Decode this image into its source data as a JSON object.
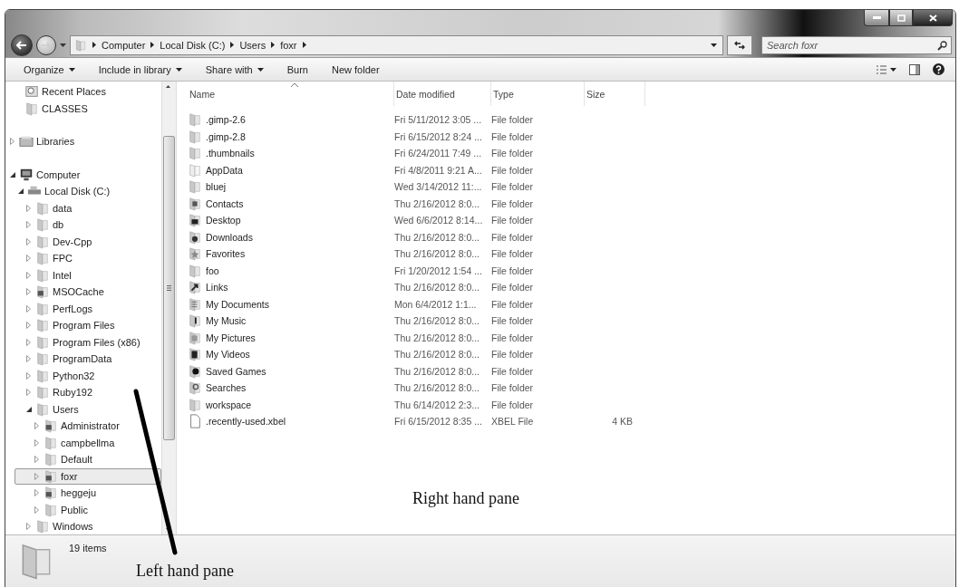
{
  "address_bar": {
    "breadcrumbs": [
      "Computer",
      "Local Disk (C:)",
      "Users",
      "foxr"
    ]
  },
  "search": {
    "placeholder": "Search foxr"
  },
  "toolbar": {
    "items": [
      {
        "label": "Organize",
        "dropdown": true
      },
      {
        "label": "Include in library",
        "dropdown": true
      },
      {
        "label": "Share with",
        "dropdown": true
      },
      {
        "label": "Burn",
        "dropdown": false
      },
      {
        "label": "New folder",
        "dropdown": false
      }
    ]
  },
  "nav_pane": {
    "sections": [
      {
        "items": [
          {
            "label": "Recent Places",
            "kind": "recent",
            "selected": false
          },
          {
            "label": "CLASSES",
            "kind": "folder",
            "selected": false
          }
        ]
      },
      {
        "items": [
          {
            "label": "Libraries",
            "kind": "library",
            "expanded": false,
            "selected": false
          }
        ]
      },
      {
        "items": [
          {
            "label": "Computer",
            "kind": "computer",
            "expanded": true,
            "selected": false,
            "children": [
              {
                "label": "Local Disk (C:)",
                "kind": "disk",
                "expanded": true,
                "selected": false,
                "children": [
                  {
                    "label": "data",
                    "kind": "folder",
                    "expanded": false,
                    "selected": false
                  },
                  {
                    "label": "db",
                    "kind": "folder",
                    "expanded": false,
                    "selected": false
                  },
                  {
                    "label": "Dev-Cpp",
                    "kind": "folder",
                    "expanded": false,
                    "selected": false
                  },
                  {
                    "label": "FPC",
                    "kind": "folder",
                    "expanded": false,
                    "selected": false
                  },
                  {
                    "label": "Intel",
                    "kind": "folder",
                    "expanded": false,
                    "selected": false
                  },
                  {
                    "label": "MSOCache",
                    "kind": "locked",
                    "expanded": false,
                    "selected": false
                  },
                  {
                    "label": "PerfLogs",
                    "kind": "folder",
                    "expanded": false,
                    "selected": false
                  },
                  {
                    "label": "Program Files",
                    "kind": "folder",
                    "expanded": false,
                    "selected": false
                  },
                  {
                    "label": "Program Files (x86)",
                    "kind": "folder",
                    "expanded": false,
                    "selected": false
                  },
                  {
                    "label": "ProgramData",
                    "kind": "folder",
                    "expanded": false,
                    "selected": false
                  },
                  {
                    "label": "Python32",
                    "kind": "folder",
                    "expanded": false,
                    "selected": false
                  },
                  {
                    "label": "Ruby192",
                    "kind": "folder",
                    "expanded": false,
                    "selected": false
                  },
                  {
                    "label": "Users",
                    "kind": "folder",
                    "expanded": true,
                    "selected": false,
                    "children": [
                      {
                        "label": "Administrator",
                        "kind": "locked",
                        "expanded": false,
                        "selected": false
                      },
                      {
                        "label": "campbellma",
                        "kind": "folder",
                        "expanded": false,
                        "selected": false
                      },
                      {
                        "label": "Default",
                        "kind": "folder",
                        "expanded": false,
                        "selected": false
                      },
                      {
                        "label": "foxr",
                        "kind": "locked",
                        "expanded": false,
                        "selected": true
                      },
                      {
                        "label": "heggeju",
                        "kind": "locked",
                        "expanded": false,
                        "selected": false
                      },
                      {
                        "label": "Public",
                        "kind": "folder",
                        "expanded": false,
                        "selected": false
                      }
                    ]
                  },
                  {
                    "label": "Windows",
                    "kind": "folder",
                    "expanded": false,
                    "selected": false
                  }
                ]
              }
            ]
          }
        ]
      }
    ]
  },
  "file_list": {
    "columns": [
      {
        "label": "Name",
        "sorted": true
      },
      {
        "label": "Date modified",
        "sorted": false
      },
      {
        "label": "Type",
        "sorted": false
      },
      {
        "label": "Size",
        "sorted": false
      }
    ],
    "rows": [
      {
        "kind": "folder",
        "name": ".gimp-2.6",
        "date": "Fri 5/11/2012 3:05 ...",
        "type": "File folder"
      },
      {
        "kind": "folder",
        "name": ".gimp-2.8",
        "date": "Fri 6/15/2012 8:24 ...",
        "type": "File folder"
      },
      {
        "kind": "folder",
        "name": ".thumbnails",
        "date": "Fri 6/24/2011 7:49 ...",
        "type": "File folder"
      },
      {
        "kind": "hidden",
        "name": "AppData",
        "date": "Fri 4/8/2011 9:21 A...",
        "type": "File folder"
      },
      {
        "kind": "folder",
        "name": "bluej",
        "date": "Wed 3/14/2012 11:...",
        "type": "File folder"
      },
      {
        "kind": "contacts",
        "name": "Contacts",
        "date": "Thu 2/16/2012 8:0...",
        "type": "File folder"
      },
      {
        "kind": "desktop",
        "name": "Desktop",
        "date": "Wed 6/6/2012 8:14...",
        "type": "File folder"
      },
      {
        "kind": "downloads",
        "name": "Downloads",
        "date": "Thu 2/16/2012 8:0...",
        "type": "File folder"
      },
      {
        "kind": "favorites",
        "name": "Favorites",
        "date": "Thu 2/16/2012 8:0...",
        "type": "File folder"
      },
      {
        "kind": "folder",
        "name": "foo",
        "date": "Fri 1/20/2012 1:54 ...",
        "type": "File folder"
      },
      {
        "kind": "links",
        "name": "Links",
        "date": "Thu 2/16/2012 8:0...",
        "type": "File folder"
      },
      {
        "kind": "documents",
        "name": "My Documents",
        "date": "Mon 6/4/2012 1:1...",
        "type": "File folder"
      },
      {
        "kind": "music",
        "name": "My Music",
        "date": "Thu 2/16/2012 8:0...",
        "type": "File folder"
      },
      {
        "kind": "pictures",
        "name": "My Pictures",
        "date": "Thu 2/16/2012 8:0...",
        "type": "File folder"
      },
      {
        "kind": "videos",
        "name": "My Videos",
        "date": "Thu 2/16/2012 8:0...",
        "type": "File folder"
      },
      {
        "kind": "games",
        "name": "Saved Games",
        "date": "Thu 2/16/2012 8:0...",
        "type": "File folder"
      },
      {
        "kind": "searches",
        "name": "Searches",
        "date": "Thu 2/16/2012 8:0...",
        "type": "File folder"
      },
      {
        "kind": "folder",
        "name": "workspace",
        "date": "Thu 6/14/2012 2:3...",
        "type": "File folder"
      },
      {
        "kind": "file",
        "name": ".recently-used.xbel",
        "date": "Fri 6/15/2012 8:35 ...",
        "type": "XBEL File",
        "size": "4 KB"
      }
    ]
  },
  "status_bar": {
    "item_count": "19 items"
  },
  "annotations": [
    {
      "kind": "right",
      "text": "Right hand pane"
    },
    {
      "kind": "left",
      "text": "Left hand pane"
    }
  ]
}
